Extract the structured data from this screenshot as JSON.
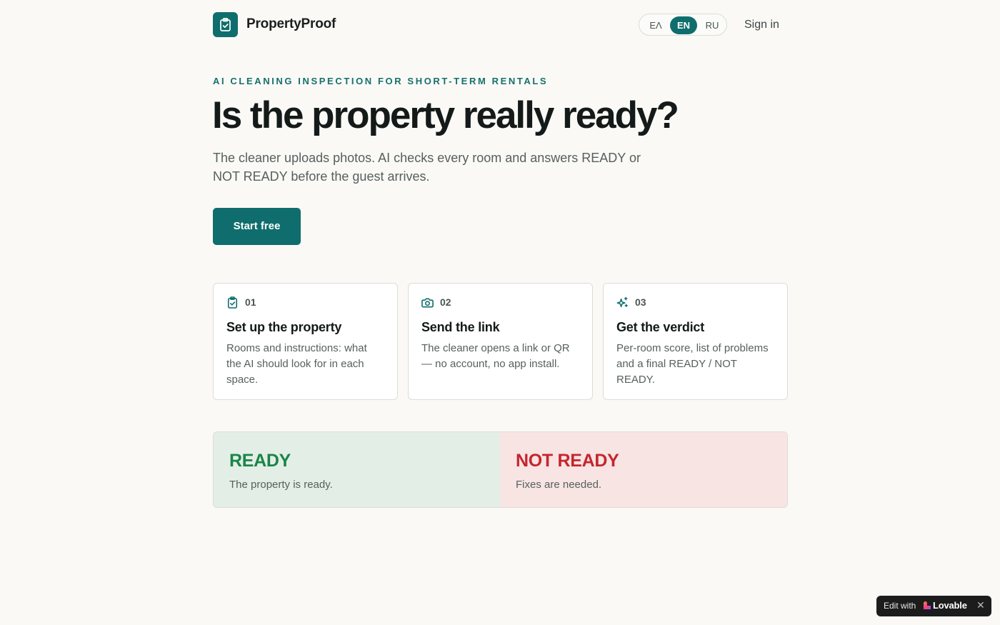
{
  "brand": {
    "name": "PropertyProof",
    "logo_icon": "clipboard-check-icon",
    "accent": "#0f6e6d"
  },
  "nav": {
    "languages": [
      {
        "code": "ΕΛ",
        "active": false
      },
      {
        "code": "EN",
        "active": true
      },
      {
        "code": "RU",
        "active": false
      }
    ],
    "sign_in": "Sign in"
  },
  "hero": {
    "eyebrow": "AI CLEANING INSPECTION FOR SHORT-TERM RENTALS",
    "title": "Is the property really ready?",
    "lead": "The cleaner uploads photos. AI checks every room and answers READY or NOT READY before the guest arrives.",
    "cta": "Start free"
  },
  "steps": [
    {
      "icon": "clipboard-check-icon",
      "num": "01",
      "title": "Set up the property",
      "desc": "Rooms and instructions: what the AI should look for in each space."
    },
    {
      "icon": "camera-icon",
      "num": "02",
      "title": "Send the link",
      "desc": "The cleaner opens a link or QR — no account, no app install."
    },
    {
      "icon": "sparkles-icon",
      "num": "03",
      "title": "Get the verdict",
      "desc": "Per-room score, list of problems and a final READY / NOT READY."
    }
  ],
  "verdict": {
    "ready": {
      "title": "READY",
      "desc": "The property is ready.",
      "color": "#1a8548"
    },
    "not_ready": {
      "title": "NOT READY",
      "desc": "Fixes are needed.",
      "color": "#c4262e"
    }
  },
  "badge": {
    "edit_label": "Edit with",
    "brand": "Lovable",
    "close_icon": "close-icon"
  }
}
